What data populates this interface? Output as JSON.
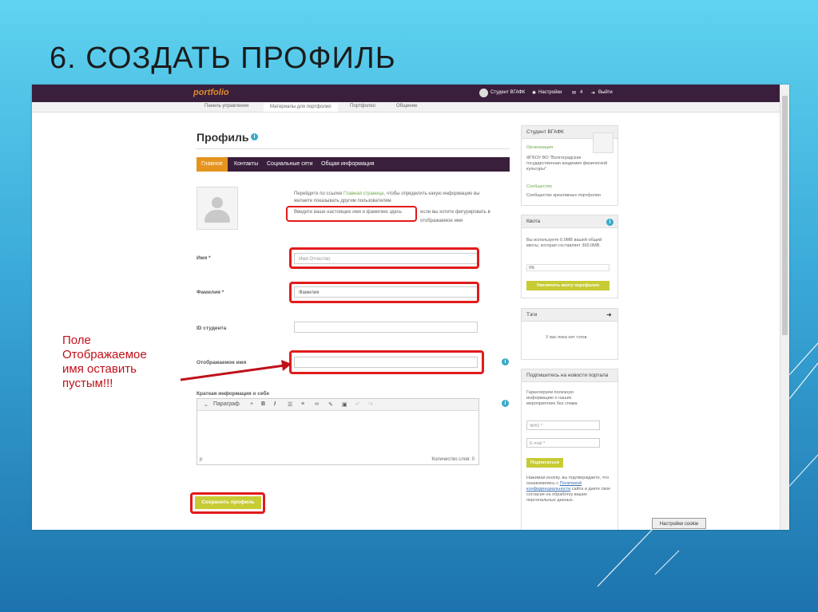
{
  "slide": {
    "title": "6. СОЗДАТЬ ПРОФИЛЬ",
    "annotation_lines": [
      "Поле",
      "Отображаемое",
      "имя оставить",
      "пустым!!!"
    ]
  },
  "app": {
    "logo": "portfolio",
    "user_name": "Студент ВГАФК",
    "settings_label": "Настройки",
    "messages_count": "4",
    "logout_label": "Выйти",
    "nav": [
      "Панель управления",
      "Материалы для портфолио",
      "Портфолио",
      "Общение"
    ]
  },
  "profile": {
    "heading": "Профиль",
    "tabs": [
      "Главное",
      "Контакты",
      "Социальные сети",
      "Общая информация"
    ],
    "intro_line1_prefix": "Перейдите по ссылке",
    "intro_link": "Главная страница",
    "intro_line1_suffix": ", чтобы определить какую информацию вы",
    "intro_line2": "желаете показывать другим пользователям",
    "intro_line3_boxed": "Введите ваше настоящее имя и фамилию здесь",
    "intro_line3_rest": "если вы хотите фигурировать в",
    "intro_line4": "отображаемое имя",
    "fields": {
      "first_name_label": "Имя *",
      "first_name_placeholder": "Имя Отчество",
      "last_name_label": "Фамилия *",
      "last_name_value": "Фамилия",
      "student_id_label": "ID студента",
      "display_name_label": "Отображаемое имя",
      "bio_label": "Краткая информация о себе"
    },
    "editor": {
      "paragraph": "Параграф",
      "status_path": "p",
      "word_count": "Количество слов: 0"
    },
    "save_button": "Сохранить профиль"
  },
  "sidebar": {
    "user_card": {
      "name": "Студент ВГАФК",
      "org_label": "Организация",
      "org_name": "ФГБОУ ВО \"Волгоградская государственная академия физической культуры\"",
      "community_label": "Сообщество",
      "community_name": "Сообщество креативных портфолио"
    },
    "quota": {
      "title": "Квота",
      "text": "Вы используете 0.0MB вашей общей квоты, которая составляет 300.0MB.",
      "percent": "0%",
      "button": "Увеличить квоту портфолио"
    },
    "tags": {
      "title": "Тэги",
      "empty": "У вас пока нет тэгов"
    },
    "newsletter": {
      "title": "Подпишитесь на новости портала",
      "text": "Гарантируем полезную информацию о наших мероприятиях без спама",
      "name_placeholder": "ФИО *",
      "email_placeholder": "E-mail *",
      "button": "Подписаться",
      "consent_prefix": "Нажимая кнопку, вы подтверждаете, что ознакомились с",
      "consent_link": "Политикой конфиденциальности",
      "consent_suffix": "сайта и даете свое согласие на обработку ваших персональных данных."
    }
  },
  "cookie_button": "Настройки cookie"
}
